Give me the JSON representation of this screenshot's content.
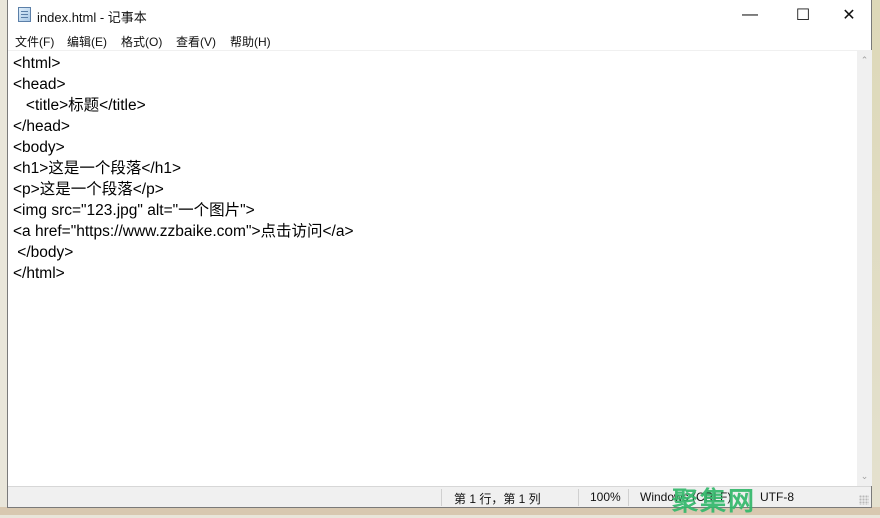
{
  "window": {
    "title": "index.html - 记事本",
    "controls": {
      "minimize": "—",
      "maximize": "☐",
      "close": "✕"
    }
  },
  "menu": {
    "items": [
      {
        "label": "文件(F)"
      },
      {
        "label": "编辑(E)"
      },
      {
        "label": "格式(O)"
      },
      {
        "label": "查看(V)"
      },
      {
        "label": "帮助(H)"
      }
    ]
  },
  "editor": {
    "lines": [
      "<html>",
      "<head>",
      "   <title>标题</title>",
      "</head>",
      "<body>",
      "<h1>这是一个段落</h1>",
      "<p>这是一个段落</p>",
      "<img src=\"123.jpg\" alt=\"一个图片\">",
      "<a href=\"https://www.zzbaike.com\">点击访问</a>",
      " </body>",
      "</html>"
    ]
  },
  "scrollbar": {
    "up": "⌃",
    "down": "⌄"
  },
  "status": {
    "position": "第 1 行，第 1 列",
    "zoom": "100%",
    "line_ending": "Windows (CRLF)",
    "encoding": "UTF-8"
  },
  "watermark": {
    "text": "聚集网",
    "color": "#33b86b"
  }
}
